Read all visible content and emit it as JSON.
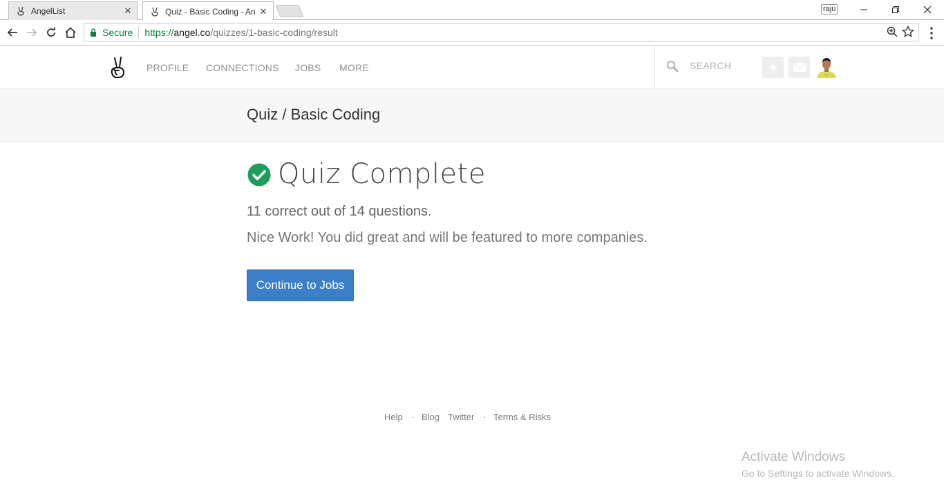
{
  "browser": {
    "tabs": [
      {
        "title": "AngelList",
        "active": false
      },
      {
        "title": "Quiz - Basic Coding - An",
        "active": true
      }
    ],
    "profile_name": "raju",
    "secure_label": "Secure",
    "url": {
      "scheme": "https://",
      "host": "angel.co",
      "path": "/quizzes/1-basic-coding/result"
    }
  },
  "header": {
    "nav": [
      "PROFILE",
      "CONNECTIONS",
      "JOBS",
      "MORE"
    ],
    "search_placeholder": "SEARCH"
  },
  "breadcrumb": {
    "title": "Quiz / Basic Coding"
  },
  "result": {
    "heading": "Quiz Complete",
    "score_text": "11 correct out of 14 questions.",
    "message": "Nice Work! You did great and will be featured to more companies.",
    "button_label": "Continue to Jobs"
  },
  "footer": {
    "help": "Help",
    "separator": "·",
    "blog": "Blog",
    "twitter": "Twitter",
    "terms": "Terms & Risks"
  },
  "watermark": {
    "title": "Activate Windows",
    "subtitle": "Go to Settings to activate Windows."
  },
  "colors": {
    "primary_button": "#3b7fc9",
    "success_check": "#1e9e5a",
    "secure_green": "#0b8043"
  }
}
